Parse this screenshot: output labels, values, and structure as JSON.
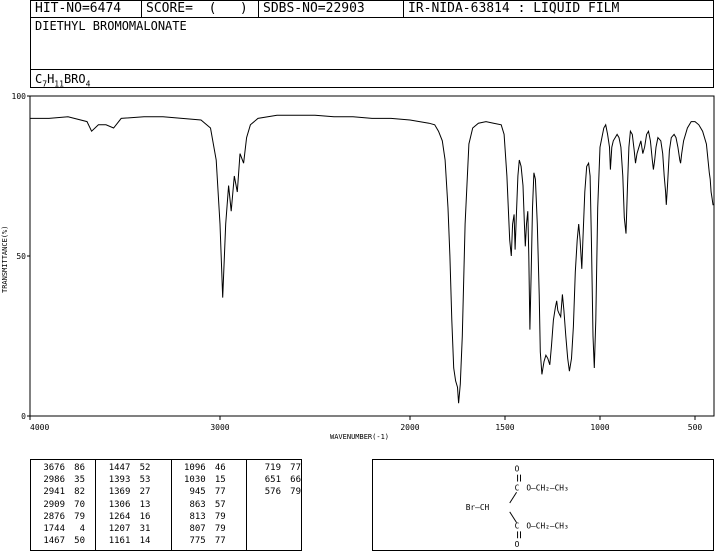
{
  "header": {
    "hit_no": "HIT-NO=6474",
    "score": "SCORE=  (   )",
    "sdbs_no": "SDBS-NO=22903",
    "ir_nida": "IR-NIDA-63814 : LIQUID FILM"
  },
  "compound_name": "DIETHYL BROMOMALONATE",
  "formula": {
    "c": "C",
    "c_sub": "7",
    "h": "H",
    "h_sub": "11",
    "rest": "BRO",
    "o_sub": "4"
  },
  "structure": {
    "o_top": "O",
    "o_bottom": "O",
    "c_top": "C",
    "c_bottom": "C",
    "ester_top": "O—CH₂—CH₃",
    "ester_bottom": "O—CH₂—CH₃",
    "center": "Br—CH"
  },
  "chart_data": {
    "type": "line",
    "xlabel": "WAVENUMBER(-1)",
    "ylabel": "TRANSMITTANCE(%)",
    "xlim": [
      4000,
      400
    ],
    "ylim": [
      0,
      100
    ],
    "x_ticks": [
      4000,
      3000,
      2000,
      1500,
      1000,
      500
    ],
    "y_ticks": [
      0,
      50,
      100
    ],
    "grid": false,
    "series": [
      {
        "points": [
          [
            4000,
            93
          ],
          [
            3900,
            93
          ],
          [
            3800,
            93.5
          ],
          [
            3700,
            92
          ],
          [
            3676,
            89
          ],
          [
            3640,
            91
          ],
          [
            3600,
            91
          ],
          [
            3560,
            90
          ],
          [
            3520,
            93
          ],
          [
            3400,
            93.5
          ],
          [
            3300,
            93.5
          ],
          [
            3200,
            93
          ],
          [
            3100,
            92.5
          ],
          [
            3050,
            90
          ],
          [
            3020,
            80
          ],
          [
            3000,
            60
          ],
          [
            2986,
            37
          ],
          [
            2970,
            60
          ],
          [
            2955,
            72
          ],
          [
            2941,
            64
          ],
          [
            2925,
            75
          ],
          [
            2909,
            70
          ],
          [
            2895,
            82
          ],
          [
            2876,
            79
          ],
          [
            2860,
            87
          ],
          [
            2840,
            91
          ],
          [
            2800,
            93
          ],
          [
            2700,
            94
          ],
          [
            2600,
            94
          ],
          [
            2500,
            94
          ],
          [
            2400,
            93.5
          ],
          [
            2300,
            93.5
          ],
          [
            2200,
            93
          ],
          [
            2100,
            93
          ],
          [
            2000,
            92.5
          ],
          [
            1950,
            92
          ],
          [
            1900,
            91.5
          ],
          [
            1870,
            91
          ],
          [
            1850,
            89
          ],
          [
            1830,
            86
          ],
          [
            1815,
            80
          ],
          [
            1800,
            65
          ],
          [
            1790,
            50
          ],
          [
            1780,
            30
          ],
          [
            1770,
            15
          ],
          [
            1760,
            11
          ],
          [
            1750,
            9
          ],
          [
            1744,
            4
          ],
          [
            1735,
            10
          ],
          [
            1725,
            25
          ],
          [
            1710,
            60
          ],
          [
            1690,
            85
          ],
          [
            1670,
            90
          ],
          [
            1640,
            91.5
          ],
          [
            1600,
            92
          ],
          [
            1560,
            91.5
          ],
          [
            1520,
            91
          ],
          [
            1505,
            88
          ],
          [
            1490,
            75
          ],
          [
            1475,
            55
          ],
          [
            1467,
            50
          ],
          [
            1460,
            60
          ],
          [
            1452,
            63
          ],
          [
            1447,
            52
          ],
          [
            1440,
            63
          ],
          [
            1432,
            75
          ],
          [
            1425,
            80
          ],
          [
            1415,
            78
          ],
          [
            1405,
            72
          ],
          [
            1398,
            60
          ],
          [
            1393,
            53
          ],
          [
            1387,
            60
          ],
          [
            1380,
            64
          ],
          [
            1375,
            50
          ],
          [
            1369,
            27
          ],
          [
            1362,
            45
          ],
          [
            1355,
            65
          ],
          [
            1348,
            76
          ],
          [
            1340,
            74
          ],
          [
            1330,
            60
          ],
          [
            1320,
            38
          ],
          [
            1314,
            20
          ],
          [
            1306,
            13
          ],
          [
            1295,
            17
          ],
          [
            1285,
            19
          ],
          [
            1275,
            18
          ],
          [
            1264,
            16
          ],
          [
            1255,
            22
          ],
          [
            1245,
            30
          ],
          [
            1235,
            34
          ],
          [
            1228,
            36
          ],
          [
            1222,
            33
          ],
          [
            1215,
            32
          ],
          [
            1207,
            31
          ],
          [
            1198,
            38
          ],
          [
            1190,
            33
          ],
          [
            1180,
            25
          ],
          [
            1170,
            18
          ],
          [
            1161,
            14
          ],
          [
            1150,
            18
          ],
          [
            1140,
            28
          ],
          [
            1130,
            45
          ],
          [
            1120,
            55
          ],
          [
            1112,
            60
          ],
          [
            1105,
            55
          ],
          [
            1096,
            46
          ],
          [
            1090,
            55
          ],
          [
            1080,
            70
          ],
          [
            1070,
            78
          ],
          [
            1060,
            79
          ],
          [
            1052,
            75
          ],
          [
            1045,
            55
          ],
          [
            1037,
            25
          ],
          [
            1030,
            15
          ],
          [
            1022,
            30
          ],
          [
            1012,
            65
          ],
          [
            1000,
            84
          ],
          [
            990,
            87
          ],
          [
            980,
            90
          ],
          [
            970,
            91
          ],
          [
            960,
            88
          ],
          [
            950,
            84
          ],
          [
            945,
            77
          ],
          [
            938,
            84
          ],
          [
            930,
            86
          ],
          [
            920,
            87
          ],
          [
            910,
            88
          ],
          [
            900,
            87
          ],
          [
            890,
            84
          ],
          [
            880,
            75
          ],
          [
            872,
            62
          ],
          [
            863,
            57
          ],
          [
            855,
            72
          ],
          [
            848,
            84
          ],
          [
            840,
            89
          ],
          [
            830,
            88
          ],
          [
            820,
            83
          ],
          [
            813,
            79
          ],
          [
            805,
            82
          ],
          [
            795,
            84
          ],
          [
            785,
            86
          ],
          [
            775,
            82
          ],
          [
            765,
            84
          ],
          [
            755,
            88
          ],
          [
            745,
            89
          ],
          [
            735,
            86
          ],
          [
            725,
            80
          ],
          [
            719,
            77
          ],
          [
            712,
            80
          ],
          [
            705,
            84
          ],
          [
            695,
            87
          ],
          [
            680,
            86
          ],
          [
            670,
            82
          ],
          [
            662,
            75
          ],
          [
            655,
            70
          ],
          [
            651,
            66
          ],
          [
            645,
            72
          ],
          [
            635,
            83
          ],
          [
            625,
            87
          ],
          [
            610,
            88
          ],
          [
            600,
            87
          ],
          [
            590,
            84
          ],
          [
            580,
            80
          ],
          [
            576,
            79
          ],
          [
            570,
            82
          ],
          [
            560,
            86
          ],
          [
            540,
            90
          ],
          [
            520,
            92
          ],
          [
            500,
            92
          ],
          [
            480,
            91
          ],
          [
            460,
            89
          ],
          [
            440,
            85
          ],
          [
            425,
            76
          ],
          [
            420,
            74
          ],
          [
            415,
            70
          ],
          [
            410,
            68
          ],
          [
            405,
            66
          ],
          [
            400,
            66
          ]
        ]
      }
    ]
  },
  "peak_table": [
    [
      [
        3676,
        86
      ],
      [
        2986,
        35
      ],
      [
        2941,
        82
      ],
      [
        2909,
        70
      ],
      [
        2876,
        79
      ],
      [
        1744,
        4
      ],
      [
        1467,
        50
      ]
    ],
    [
      [
        1447,
        52
      ],
      [
        1393,
        53
      ],
      [
        1369,
        27
      ],
      [
        1306,
        13
      ],
      [
        1264,
        16
      ],
      [
        1207,
        31
      ],
      [
        1161,
        14
      ]
    ],
    [
      [
        1096,
        46
      ],
      [
        1030,
        15
      ],
      [
        945,
        77
      ],
      [
        863,
        57
      ],
      [
        813,
        79
      ],
      [
        807,
        79
      ],
      [
        775,
        77
      ]
    ],
    [
      [
        719,
        77
      ],
      [
        651,
        66
      ],
      [
        576,
        79
      ]
    ]
  ]
}
